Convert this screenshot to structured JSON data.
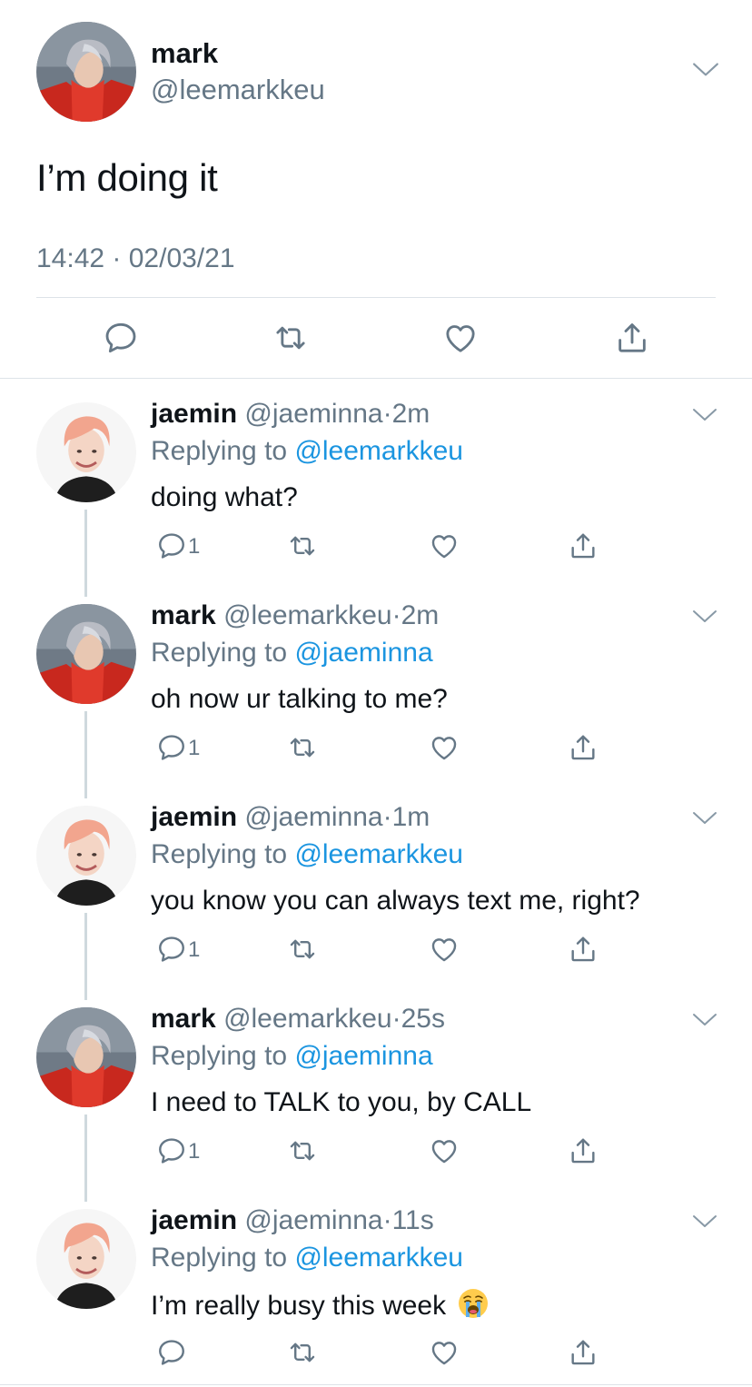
{
  "main_tweet": {
    "name": "mark",
    "handle": "@leemarkkeu",
    "text": "I’m doing it",
    "timestamp": "14:42 · 02/03/21",
    "avatar": "mark-avatar",
    "actions": [
      "reply-icon",
      "retweet-icon",
      "like-icon",
      "share-icon"
    ]
  },
  "replies": [
    {
      "name": "jaemin",
      "handle": "@jaeminna",
      "sep": "·",
      "time": "2m",
      "replying_prefix": "Replying to ",
      "replying_to": "@leemarkkeu",
      "text": "doing what?",
      "reply_count": "1",
      "avatar": "jaemin-avatar"
    },
    {
      "name": "mark",
      "handle": "@leemarkkeu",
      "sep": "·",
      "time": "2m",
      "replying_prefix": "Replying to ",
      "replying_to": "@jaeminna",
      "text": "oh now ur talking to me?",
      "reply_count": "1",
      "avatar": "mark-avatar"
    },
    {
      "name": "jaemin",
      "handle": "@jaeminna",
      "sep": "·",
      "time": "1m",
      "replying_prefix": "Replying to ",
      "replying_to": "@leemarkkeu",
      "text": "you know you can always text me, right?",
      "reply_count": "1",
      "avatar": "jaemin-avatar"
    },
    {
      "name": "mark",
      "handle": "@leemarkkeu",
      "sep": "·",
      "time": "25s",
      "replying_prefix": "Replying to ",
      "replying_to": "@jaeminna",
      "text": "I need to TALK to you, by CALL",
      "reply_count": "1",
      "avatar": "mark-avatar"
    },
    {
      "name": "jaemin",
      "handle": "@jaeminna",
      "sep": "·",
      "time": "11s",
      "replying_prefix": "Replying to ",
      "replying_to": "@leemarkkeu",
      "text": "I’m really busy this week",
      "emoji": "crying-face-emoji",
      "reply_count": "",
      "avatar": "jaemin-avatar"
    }
  ],
  "colors": {
    "text": "#0f1419",
    "secondary": "#657786",
    "link": "#1b95e0",
    "divider": "#dde3e8",
    "thread_line": "#cfd9de"
  }
}
